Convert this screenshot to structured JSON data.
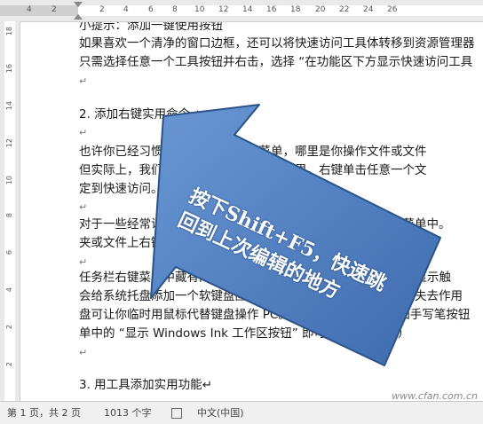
{
  "ruler": {
    "h_labels": [
      "4",
      "2",
      "",
      "2",
      "4",
      "6",
      "8",
      "10",
      "12",
      "14",
      "16",
      "18",
      "20",
      "22",
      "24",
      "26"
    ],
    "v_labels": [
      "18",
      "16",
      "14",
      "12",
      "10",
      "8",
      "6",
      "4",
      "2",
      "2",
      "4",
      "6",
      "8",
      "10",
      "12",
      "14",
      "16",
      "18",
      "20",
      "22"
    ]
  },
  "document": {
    "lines": [
      {
        "text": "小提示：添加一键使用按钮"
      },
      {
        "text": "如果喜欢一个清净的窗口边框，还可以将快速访问工具体转移到资源管理器"
      },
      {
        "text": "只需选择任意一个工具按钮并右击，选择 “在功能区下方显示快速访问工具"
      },
      {
        "text": "↵"
      },
      {
        "text": "2. 添加右键实用命令↵"
      },
      {
        "text": "↵"
      },
      {
        "text": "也许你已经习惯了传统的快速访问菜单，哪里是你操作文件或文件"
      },
      {
        "text": "但实际上，我们还可以将文件夹固定在这里。右键单击任意一个文"
      },
      {
        "text": "定到快速访问。↵"
      },
      {
        "text": "↵"
      },
      {
        "text": "对于一些经常访问的文件夹，你也可以将它们固定到开始屏幕菜单中。"
      },
      {
        "text": "夹或文件上右键单击，选择固定到开始屏幕即可。还增加常用"
      },
      {
        "text": "↵"
      },
      {
        "text": "任务栏右键菜单中藏有两个使用的命令，“显示触摸键盘按钮”和显示触"
      },
      {
        "text": "会给系统托盘添加一个软键盘图标，当鼠标出现故障时，软键盘失去作用"
      },
      {
        "text": "盘可让你临时用鼠标代替键盘操作 PC。此外还可以为系统添加手写笔按钮"
      },
      {
        "text": "单中的 “显示 Windows Ink 工作区按钮” 即可（需要触摸屏）"
      },
      {
        "text": "↵"
      },
      {
        "text": "3. 用工具添加实用功能↵"
      }
    ]
  },
  "callout": {
    "line1": "按下Shift+F5，快速跳",
    "line2": "回到上次编辑的地方",
    "fill_color": "#4f7fc0",
    "stroke_color": "#2c5288"
  },
  "statusbar": {
    "page": "第 1 页，共 2 页",
    "words": "1013 个字",
    "language": "中文(中国)"
  },
  "watermark": "www.cfan.com.cn"
}
